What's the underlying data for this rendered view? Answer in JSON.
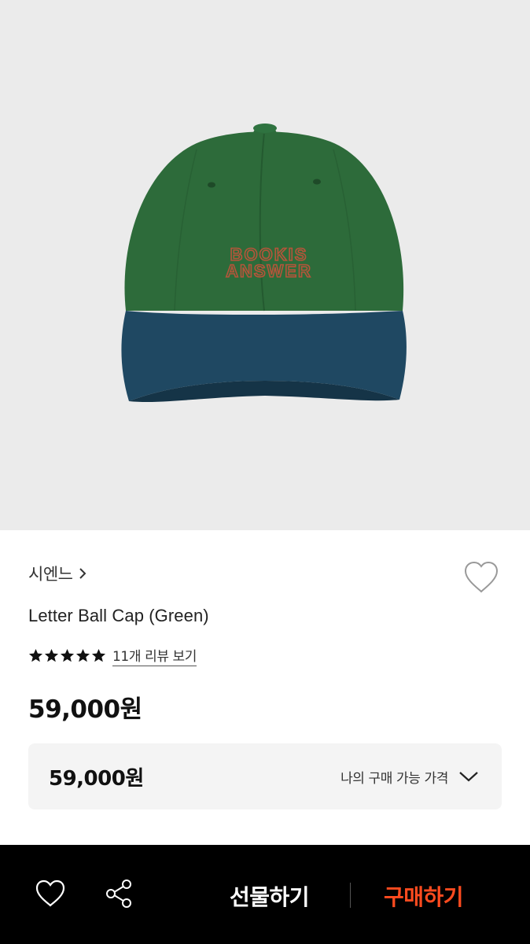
{
  "product": {
    "image_alt": "Letter Ball Cap (Green)",
    "cap_logo_line1": "BOOKIS",
    "cap_logo_line2": "ANSWER",
    "brand": "시엔느",
    "title": "Letter Ball Cap (Green)",
    "rating_stars": 5,
    "review_link": "11개 리뷰 보기",
    "price": "59,000원"
  },
  "my_price": {
    "price": "59,000원",
    "label": "나의 구매 가능 가격"
  },
  "bottom_bar": {
    "gift_label": "선물하기",
    "buy_label": "구매하기"
  },
  "icons": {
    "brand_chevron": "chevron-right-icon",
    "wishlist": "heart-outline-icon",
    "rating": "star-icon",
    "dropdown": "chevron-down-icon",
    "share": "share-icon"
  },
  "colors": {
    "hero_bg": "#ebebeb",
    "cap_crown": "#2d6b3a",
    "cap_brim": "#1f4862",
    "logo": "#b5553a",
    "buy_accent": "#ff4b1f",
    "bottom_bar_bg": "#000000"
  }
}
